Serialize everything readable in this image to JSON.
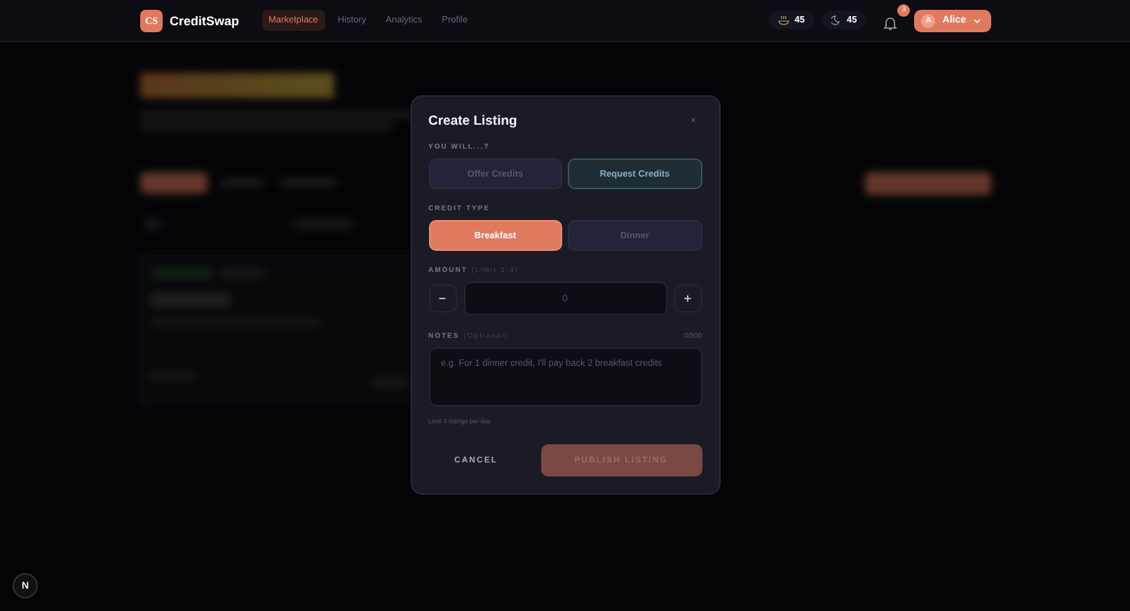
{
  "header": {
    "logo_mark": "CS",
    "brand": "CreditSwap",
    "nav": [
      {
        "label": "Marketplace",
        "selected": true
      },
      {
        "label": "History",
        "selected": false
      },
      {
        "label": "Analytics",
        "selected": false
      },
      {
        "label": "Profile",
        "selected": false
      }
    ],
    "breakfast_credits": "45",
    "dinner_credits": "45",
    "notification_count": "3",
    "user": {
      "initial": "A",
      "name": "Alice"
    }
  },
  "modal": {
    "title": "Create Listing",
    "close": "×",
    "intent_label": "YOU WILL...?",
    "intent_options": [
      {
        "label": "Offer Credits",
        "selected": false
      },
      {
        "label": "Request Credits",
        "selected": true
      }
    ],
    "credit_type_label": "CREDIT TYPE",
    "credit_types": [
      {
        "label": "Breakfast",
        "selected": true
      },
      {
        "label": "Dinner",
        "selected": false
      }
    ],
    "amount_label": "AMOUNT",
    "amount_hint": "(Limit 1-3)",
    "decrement": "−",
    "amount_placeholder": "0",
    "increment": "+",
    "notes_label": "NOTES",
    "notes_hint": "(Optional)",
    "notes_counter": "0/500",
    "notes_placeholder": "e.g. For 1 dinner credit, I'll pay back 2 breakfast credits",
    "limit_note": "Limit 3 listings per day",
    "cancel": "CANCEL",
    "publish": {
      "label": "PUBLISH LISTING",
      "disabled": true
    }
  },
  "dev_badge": "N"
}
